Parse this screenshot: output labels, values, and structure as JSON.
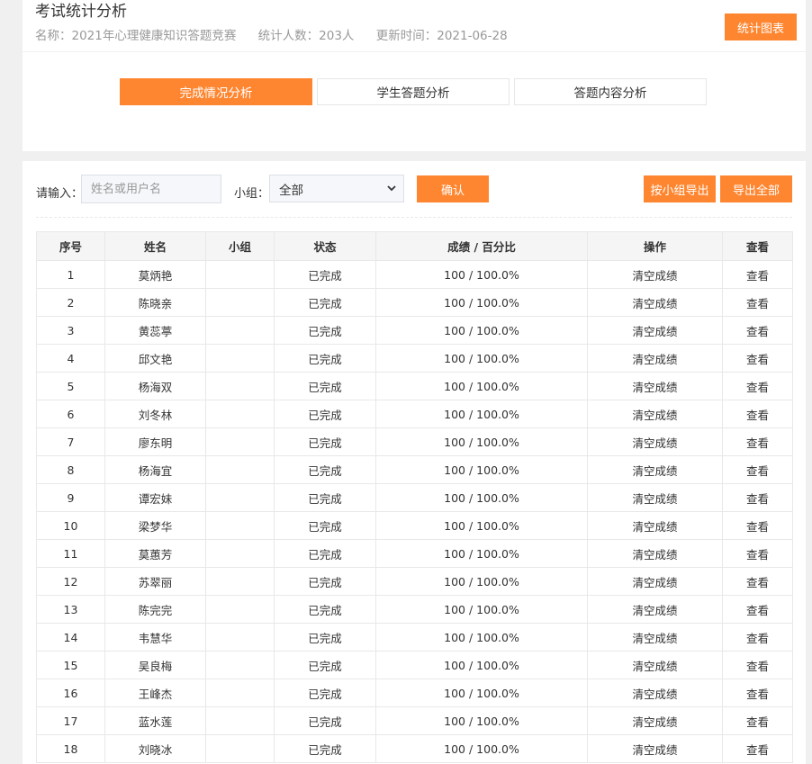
{
  "header": {
    "title": "考试统计分析",
    "name": "名称：2021年心理健康知识答题竞赛",
    "count": "统计人数：203人",
    "updated": "更新时间：2021-06-28",
    "chart_button": "统计图表"
  },
  "tabs": [
    {
      "label": "完成情况分析",
      "active": true
    },
    {
      "label": "学生答题分析",
      "active": false
    },
    {
      "label": "答题内容分析",
      "active": false
    }
  ],
  "filter": {
    "input_label": "请输入：",
    "placeholder": "姓名或用户名",
    "group_label": "小组：",
    "group_value": "全部",
    "confirm": "确认",
    "export_group": "按小组导出",
    "export_all": "导出全部"
  },
  "table": {
    "columns": [
      "序号",
      "姓名",
      "小组",
      "状态",
      "成绩 / 百分比",
      "操作",
      "查看"
    ],
    "rows": [
      {
        "no": "1",
        "name": "莫炳艳",
        "group": "",
        "status": "已完成",
        "score": "100 / 100.0%",
        "action": "清空成绩",
        "view": "查看"
      },
      {
        "no": "2",
        "name": "陈晓亲",
        "group": "",
        "status": "已完成",
        "score": "100 / 100.0%",
        "action": "清空成绩",
        "view": "查看"
      },
      {
        "no": "3",
        "name": "黄蕊葶",
        "group": "",
        "status": "已完成",
        "score": "100 / 100.0%",
        "action": "清空成绩",
        "view": "查看"
      },
      {
        "no": "4",
        "name": "邱文艳",
        "group": "",
        "status": "已完成",
        "score": "100 / 100.0%",
        "action": "清空成绩",
        "view": "查看"
      },
      {
        "no": "5",
        "name": "杨海双",
        "group": "",
        "status": "已完成",
        "score": "100 / 100.0%",
        "action": "清空成绩",
        "view": "查看"
      },
      {
        "no": "6",
        "name": "刘冬林",
        "group": "",
        "status": "已完成",
        "score": "100 / 100.0%",
        "action": "清空成绩",
        "view": "查看"
      },
      {
        "no": "7",
        "name": "廖东明",
        "group": "",
        "status": "已完成",
        "score": "100 / 100.0%",
        "action": "清空成绩",
        "view": "查看"
      },
      {
        "no": "8",
        "name": "杨海宜",
        "group": "",
        "status": "已完成",
        "score": "100 / 100.0%",
        "action": "清空成绩",
        "view": "查看"
      },
      {
        "no": "9",
        "name": "谭宏妹",
        "group": "",
        "status": "已完成",
        "score": "100 / 100.0%",
        "action": "清空成绩",
        "view": "查看"
      },
      {
        "no": "10",
        "name": "梁梦华",
        "group": "",
        "status": "已完成",
        "score": "100 / 100.0%",
        "action": "清空成绩",
        "view": "查看"
      },
      {
        "no": "11",
        "name": "莫蕙芳",
        "group": "",
        "status": "已完成",
        "score": "100 / 100.0%",
        "action": "清空成绩",
        "view": "查看"
      },
      {
        "no": "12",
        "name": "苏翠丽",
        "group": "",
        "status": "已完成",
        "score": "100 / 100.0%",
        "action": "清空成绩",
        "view": "查看"
      },
      {
        "no": "13",
        "name": "陈完完",
        "group": "",
        "status": "已完成",
        "score": "100 / 100.0%",
        "action": "清空成绩",
        "view": "查看"
      },
      {
        "no": "14",
        "name": "韦慧华",
        "group": "",
        "status": "已完成",
        "score": "100 / 100.0%",
        "action": "清空成绩",
        "view": "查看"
      },
      {
        "no": "15",
        "name": "吴良梅",
        "group": "",
        "status": "已完成",
        "score": "100 / 100.0%",
        "action": "清空成绩",
        "view": "查看"
      },
      {
        "no": "16",
        "name": "王峰杰",
        "group": "",
        "status": "已完成",
        "score": "100 / 100.0%",
        "action": "清空成绩",
        "view": "查看"
      },
      {
        "no": "17",
        "name": "蓝水莲",
        "group": "",
        "status": "已完成",
        "score": "100 / 100.0%",
        "action": "清空成绩",
        "view": "查看"
      },
      {
        "no": "18",
        "name": "刘晓冰",
        "group": "",
        "status": "已完成",
        "score": "100 / 100.0%",
        "action": "清空成绩",
        "view": "查看"
      }
    ]
  },
  "colors": {
    "accent": "#ff8630",
    "page_background": "#f0f0f0",
    "muted_text": "#999999"
  }
}
